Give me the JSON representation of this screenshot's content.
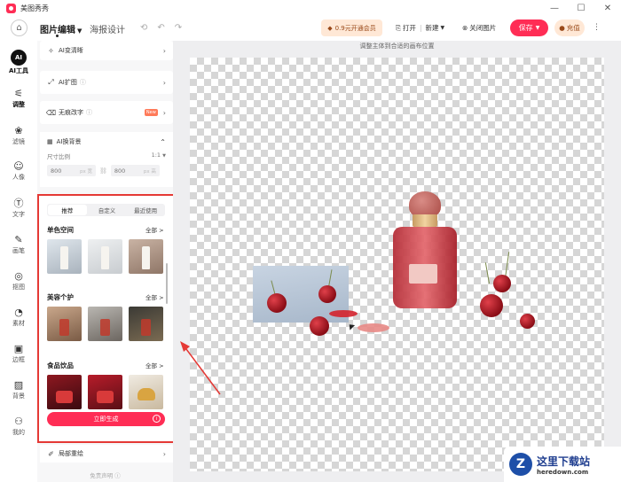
{
  "app": {
    "title": "美图秀秀"
  },
  "window_controls": {
    "minimize": "—",
    "maximize": "☐",
    "close": "✕"
  },
  "toolbar": {
    "tab_edit": "图片编辑",
    "tab_poster": "海报设计",
    "vip_label": "0.9元开通会员",
    "open_label": "打开",
    "new_label": "新建",
    "close_image_label": "关闭图片",
    "save_label": "保存",
    "recharge_label": "充值"
  },
  "rail": {
    "items": [
      {
        "label": "AI工具"
      },
      {
        "label": "调整"
      },
      {
        "label": "滤镜"
      },
      {
        "label": "人像"
      },
      {
        "label": "文字"
      },
      {
        "label": "画笔"
      },
      {
        "label": "抠图"
      },
      {
        "label": "素材"
      },
      {
        "label": "边框"
      },
      {
        "label": "背景"
      },
      {
        "label": "我的"
      }
    ],
    "ai_badge": "AI"
  },
  "panel": {
    "ai_clarity": "AI变清晰",
    "ai_expand": "AI扩图",
    "remove_text": "无痕改字",
    "new_badge": "New",
    "ai_bg": "AI换背景",
    "size_ratio_label": "尺寸比例",
    "size_ratio_value": "1:1",
    "width": "800",
    "width_unit": "px 宽",
    "height": "800",
    "height_unit": "px 高",
    "tabs": [
      "推荐",
      "自定义",
      "最近使用"
    ],
    "categories": [
      {
        "title": "单色空间",
        "all": "全部 >"
      },
      {
        "title": "美容个护",
        "all": "全部 >"
      },
      {
        "title": "食品饮品",
        "all": "全部 >"
      }
    ],
    "generate_label": "立即生成",
    "local_redraw": "局部重绘",
    "disclaimer": "免责声明"
  },
  "canvas": {
    "hint": "调整主体到合适的画布位置"
  },
  "watermark": {
    "cn": "这里下载站",
    "en": "heredown.com",
    "logo": "Z"
  },
  "colors": {
    "accent": "#ff2d55",
    "highlight_box": "#e53935",
    "vip_bg": "#ffe8d6"
  }
}
